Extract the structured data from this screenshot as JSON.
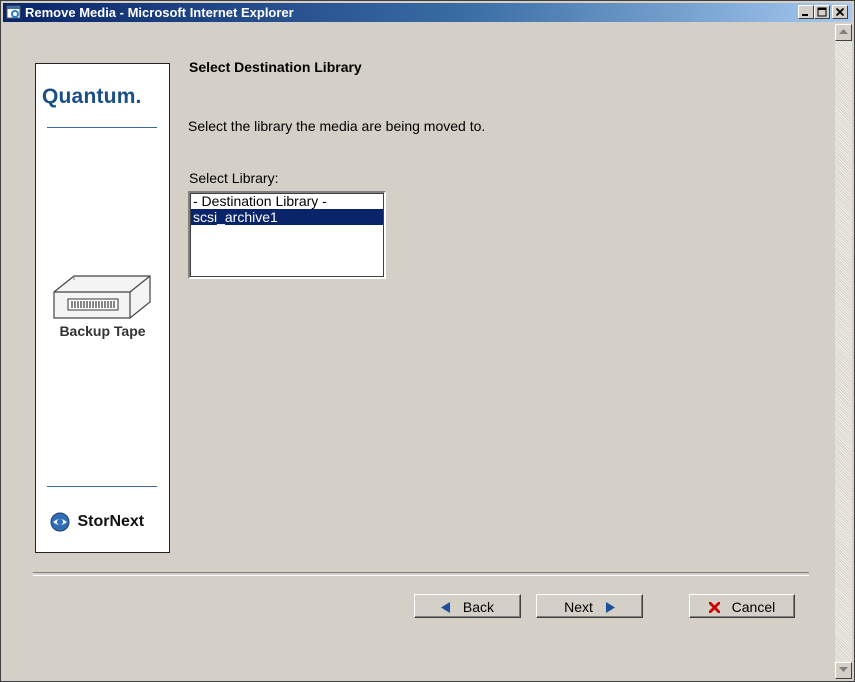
{
  "window": {
    "title": "Remove Media - Microsoft Internet Explorer",
    "controls": [
      "minimize",
      "maximize",
      "close"
    ]
  },
  "brand": {
    "company": "Quantum.",
    "product_icon": "tape-drive-icon",
    "product_label": "Backup Tape",
    "footer_logo": "StorNext"
  },
  "main": {
    "title": "Select Destination Library",
    "instruction": "Select the library the media are being moved to.",
    "select_label": "Select Library:",
    "library_options": [
      {
        "label": "- Destination Library -",
        "selected": false
      },
      {
        "label": "scsi_archive1",
        "selected": true
      }
    ]
  },
  "buttons": {
    "back": "Back",
    "next": "Next",
    "cancel": "Cancel"
  },
  "colors": {
    "titlebar_start": "#0a246a",
    "selection": "#0a246a",
    "brand_blue": "#1a4f87",
    "cancel_icon": "#cc0000",
    "arrow_icon": "#1c4f9c"
  }
}
